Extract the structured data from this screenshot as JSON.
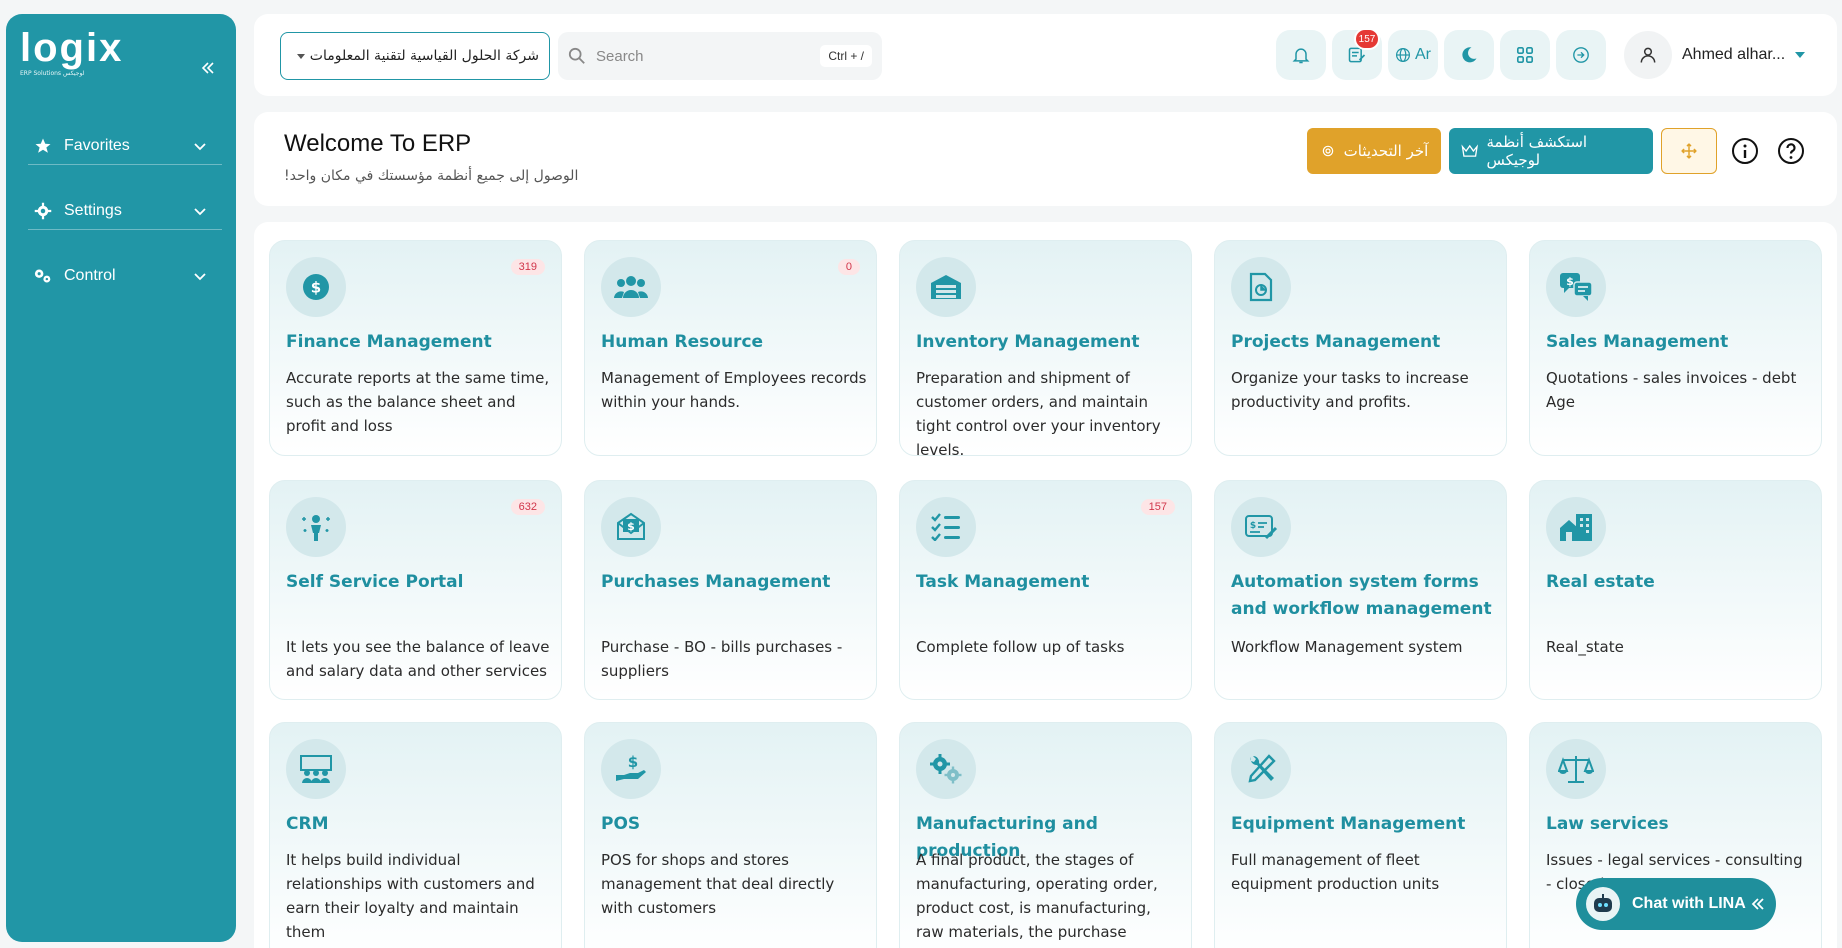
{
  "brand": {
    "logo_text": "logix",
    "logo_sub": "ERP Solutions  لوجيكس"
  },
  "sidebar": {
    "items": [
      {
        "label": "Favorites",
        "icon": "star-icon"
      },
      {
        "label": "Settings",
        "icon": "gear-icon"
      },
      {
        "label": "Control",
        "icon": "gears-icon"
      }
    ]
  },
  "topbar": {
    "company": "شركة الحلول القياسية لتقنية المعلومات",
    "search_placeholder": "Search",
    "search_shortcut": "Ctrl + /",
    "messages_badge": "157",
    "language": "Ar",
    "user_name": "Ahmed alhar..."
  },
  "welcome": {
    "title": "Welcome To ERP",
    "subtitle": "الوصول إلى جميع أنظمة مؤسستك في مكان واحد!",
    "updates_btn": "آخر التحديثات",
    "discover_btn": "استكشف أنظمة لوجيكس"
  },
  "modules": [
    {
      "title": "Finance Management",
      "desc": "Accurate reports at the same time, such as the balance sheet and profit and loss",
      "count": "319",
      "icon": "dollar-icon"
    },
    {
      "title": "Human Resource",
      "desc": "Management of Employees records within your hands.",
      "count": "0",
      "icon": "users-icon"
    },
    {
      "title": "Inventory Management",
      "desc": "Preparation and shipment of customer orders, and maintain tight control over your inventory levels.",
      "count": "",
      "icon": "warehouse-icon"
    },
    {
      "title": "Projects Management",
      "desc": "Organize your tasks to increase productivity and profits.",
      "count": "",
      "icon": "project-file-icon"
    },
    {
      "title": "Sales Management",
      "desc": "Quotations - sales invoices - debt Age",
      "count": "",
      "icon": "sales-chat-icon"
    },
    {
      "title": "Self Service Portal",
      "desc": "It lets you see the balance of leave and salary data and other services",
      "count": "632",
      "icon": "person-sparkle-icon"
    },
    {
      "title": "Purchases Management",
      "desc": "Purchase - BO - bills purchases - suppliers",
      "count": "",
      "icon": "money-envelope-icon"
    },
    {
      "title": "Task Management",
      "desc": "Complete follow up of tasks",
      "count": "157",
      "icon": "checklist-icon"
    },
    {
      "title": "Automation system forms and workflow management",
      "desc": "Workflow Management system",
      "count": "",
      "icon": "form-edit-icon"
    },
    {
      "title": "Real estate",
      "desc": "Real_state",
      "count": "",
      "icon": "house-building-icon"
    },
    {
      "title": "CRM",
      "desc": "It helps build individual relationships with customers and earn their loyalty and maintain them",
      "count": "",
      "icon": "presentation-icon"
    },
    {
      "title": "POS",
      "desc": "POS for shops and stores management that deal directly with customers",
      "count": "",
      "icon": "hand-dollar-icon"
    },
    {
      "title": "Manufacturing and production",
      "desc": "A final product, the stages of manufacturing, operating order, product cost, is manufacturing, raw materials, the purchase request",
      "count": "",
      "icon": "cogs-icon"
    },
    {
      "title": "Equipment Management",
      "desc": "Full management of fleet equipment production units",
      "count": "",
      "icon": "tools-icon"
    },
    {
      "title": "Law services",
      "desc": "Issues - legal services - consulting - closed",
      "count": "",
      "icon": "scales-icon"
    }
  ],
  "chat": {
    "label": "Chat with LINA"
  },
  "colors": {
    "primary": "#2196a6",
    "accent": "#e0a22a",
    "badge": "#e53935"
  }
}
